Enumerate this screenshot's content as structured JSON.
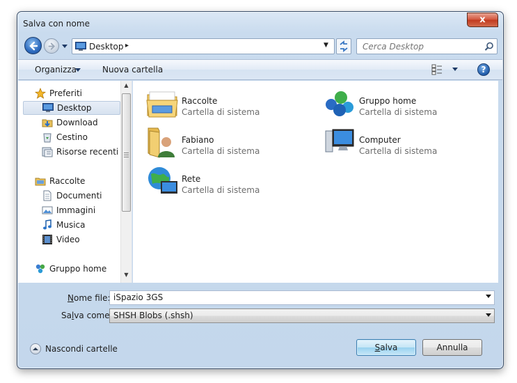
{
  "window": {
    "title": "Salva con nome",
    "close_label": "x"
  },
  "nav": {
    "address_path": "Desktop",
    "address_chevron": "▸",
    "search_placeholder": "Cerca Desktop"
  },
  "toolbar": {
    "organize_label": "Organizza",
    "new_folder_label": "Nuova cartella",
    "help_label": "?"
  },
  "sidebar": {
    "favorites": {
      "label": "Preferiti",
      "icon": "star-icon"
    },
    "favorite_items": [
      {
        "label": "Desktop",
        "icon": "desktop-icon",
        "selected": true
      },
      {
        "label": "Download",
        "icon": "downloads-icon"
      },
      {
        "label": "Cestino",
        "icon": "recycle-bin-icon"
      },
      {
        "label": "Risorse recenti",
        "icon": "recent-places-icon"
      }
    ],
    "libraries": {
      "label": "Raccolte",
      "icon": "libraries-icon"
    },
    "library_items": [
      {
        "label": "Documenti",
        "icon": "documents-icon"
      },
      {
        "label": "Immagini",
        "icon": "pictures-icon"
      },
      {
        "label": "Musica",
        "icon": "music-icon"
      },
      {
        "label": "Video",
        "icon": "video-icon"
      }
    ],
    "homegroup": {
      "label": "Gruppo home",
      "icon": "homegroup-icon"
    }
  },
  "content": {
    "items": [
      {
        "name": "Raccolte",
        "type": "Cartella di sistema",
        "icon": "libraries-icon"
      },
      {
        "name": "Gruppo home",
        "type": "Cartella di sistema",
        "icon": "homegroup-icon"
      },
      {
        "name": "Fabiano",
        "type": "Cartella di sistema",
        "icon": "user-folder-icon"
      },
      {
        "name": "Computer",
        "type": "Cartella di sistema",
        "icon": "computer-icon"
      },
      {
        "name": "Rete",
        "type": "Cartella di sistema",
        "icon": "network-icon"
      }
    ]
  },
  "form": {
    "filename_label_underlined": "N",
    "filename_label_rest": "ome file:",
    "filename_value": "iSpazio 3GS",
    "savetype_label_a": "Sa",
    "savetype_label_underlined": "l",
    "savetype_label_b": "va come:",
    "savetype_value": "SHSH Blobs (.shsh)"
  },
  "footer": {
    "hide_folders_label": "Nascondi cartelle",
    "save_underlined": "S",
    "save_rest": "alva",
    "cancel_label": "Annulla"
  },
  "colors": {
    "frame": "#c4d7ec",
    "accent": "#3c7fb1",
    "close": "#c0391e"
  }
}
